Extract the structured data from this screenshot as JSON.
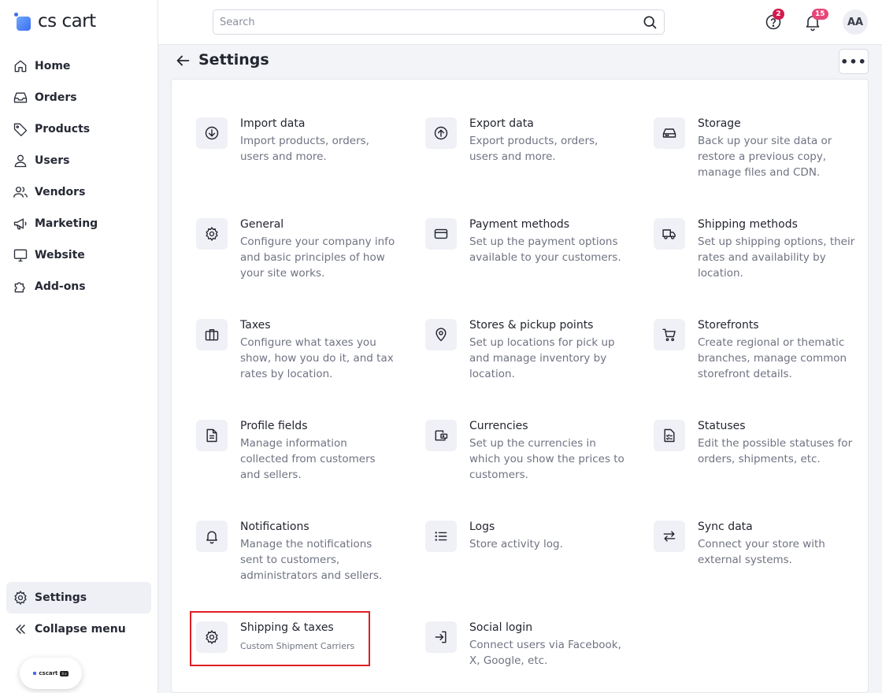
{
  "app": {
    "logo_text": "cs cart"
  },
  "sidebar": {
    "items": [
      {
        "label": "Home",
        "icon": "home-icon"
      },
      {
        "label": "Orders",
        "icon": "inbox-icon"
      },
      {
        "label": "Products",
        "icon": "tag-icon"
      },
      {
        "label": "Users",
        "icon": "user-icon"
      },
      {
        "label": "Vendors",
        "icon": "users-icon"
      },
      {
        "label": "Marketing",
        "icon": "megaphone-icon"
      },
      {
        "label": "Website",
        "icon": "monitor-icon"
      },
      {
        "label": "Add-ons",
        "icon": "puzzle-icon"
      }
    ],
    "settings_label": "Settings",
    "collapse_label": "Collapse menu",
    "promo": {
      "text": "cscart",
      "tag": "4.x"
    }
  },
  "topbar": {
    "search_placeholder": "Search",
    "help_badge": "2",
    "notifications_badge": "15",
    "avatar_initials": "AA",
    "colors": {
      "help_badge": "#d31b4f",
      "notifications_badge": "#e8457a"
    }
  },
  "header": {
    "title": "Settings",
    "more_label": "•••"
  },
  "tiles": [
    {
      "title": "Import data",
      "desc": "Import products, orders, users and more.",
      "icon": "import-icon"
    },
    {
      "title": "Export data",
      "desc": "Export products, orders, users and more.",
      "icon": "export-icon"
    },
    {
      "title": "Storage",
      "desc": "Back up your site data or restore a previous copy, manage files and CDN.",
      "icon": "storage-icon"
    },
    {
      "title": "General",
      "desc": "Configure your company info and basic principles of how your site works.",
      "icon": "gear-icon"
    },
    {
      "title": "Payment methods",
      "desc": "Set up the payment options available to your customers.",
      "icon": "credit-card-icon"
    },
    {
      "title": "Shipping methods",
      "desc": "Set up shipping options, their rates and availability by location.",
      "icon": "truck-icon"
    },
    {
      "title": "Taxes",
      "desc": "Configure what taxes you show, how you do it, and tax rates by location.",
      "icon": "briefcase-icon"
    },
    {
      "title": "Stores & pickup points",
      "desc": "Set up locations for pick up and manage inventory by location.",
      "icon": "map-pin-icon"
    },
    {
      "title": "Storefronts",
      "desc": "Create regional or thematic branches, manage common storefront details.",
      "icon": "cart-icon"
    },
    {
      "title": "Profile fields",
      "desc": "Manage information collected from customers and sellers.",
      "icon": "document-icon"
    },
    {
      "title": "Currencies",
      "desc": "Set up the currencies in which you show the prices to customers.",
      "icon": "wallet-icon"
    },
    {
      "title": "Statuses",
      "desc": "Edit the possible statuses for orders, shipments, etc.",
      "icon": "checklist-icon"
    },
    {
      "title": "Notifications",
      "desc": "Manage the notifications sent to customers, administrators and sellers.",
      "icon": "bell-icon"
    },
    {
      "title": "Logs",
      "desc": "Store activity log.",
      "icon": "list-icon"
    },
    {
      "title": "Sync data",
      "desc": "Connect your store with external systems.",
      "icon": "sync-arrows-icon"
    },
    {
      "title": "Shipping & taxes",
      "desc": "Custom Shipment Carriers",
      "icon": "gear-icon"
    },
    {
      "title": "Social login",
      "desc": "Connect users via Facebook, X, Google, etc.",
      "icon": "login-icon"
    }
  ]
}
